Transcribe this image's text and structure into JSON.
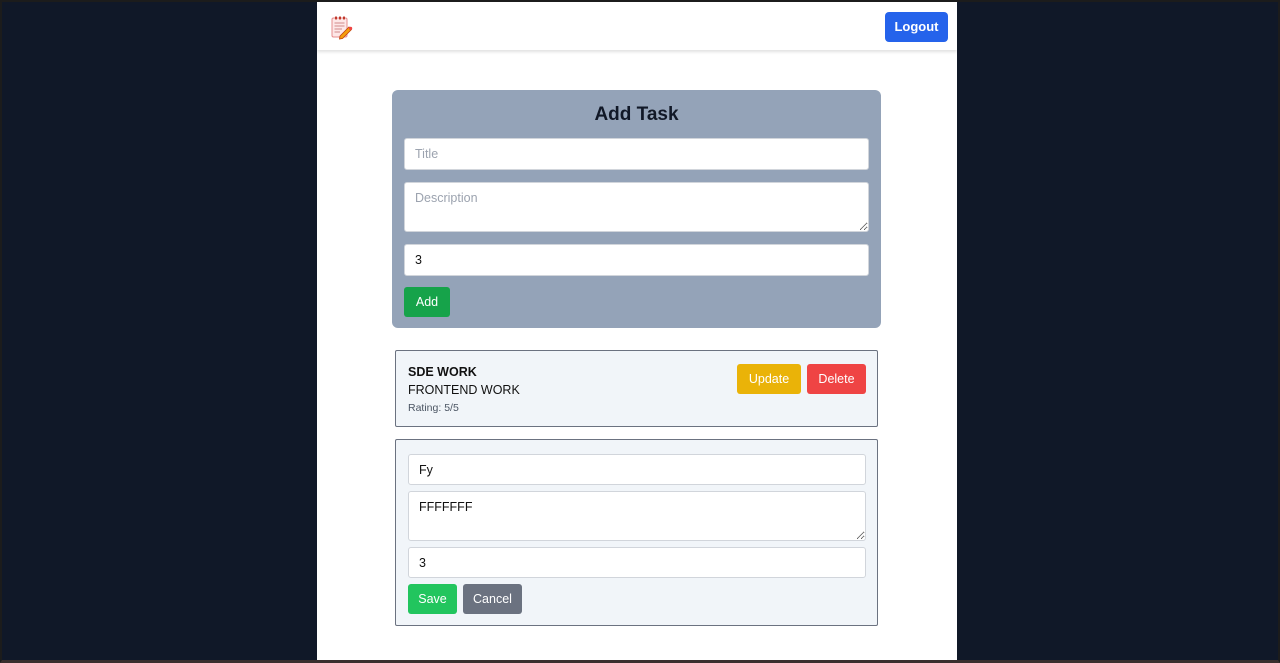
{
  "navbar": {
    "logo_icon": "notepad-pencil-icon",
    "logout_label": "Logout"
  },
  "add_task": {
    "heading": "Add Task",
    "title_placeholder": "Title",
    "title_value": "",
    "description_placeholder": "Description",
    "description_value": "",
    "rating_value": "3",
    "add_label": "Add"
  },
  "tasks": [
    {
      "title": "SDE WORK",
      "description": "FRONTEND WORK",
      "rating_label": "Rating:",
      "rating_text": "5/5",
      "update_label": "Update",
      "delete_label": "Delete"
    }
  ],
  "edit_task": {
    "title_value": "Fy",
    "description_value": "FFFFFFF",
    "rating_value": "3",
    "save_label": "Save",
    "cancel_label": "Cancel"
  },
  "colors": {
    "page_background": "#101828",
    "logout_button": "#2563eb",
    "add_button": "#16a34a",
    "update_button": "#eab308",
    "delete_button": "#ef4444",
    "save_button": "#22c55e",
    "cancel_button": "#6b7280",
    "add_card_background": "#94a3b8"
  }
}
